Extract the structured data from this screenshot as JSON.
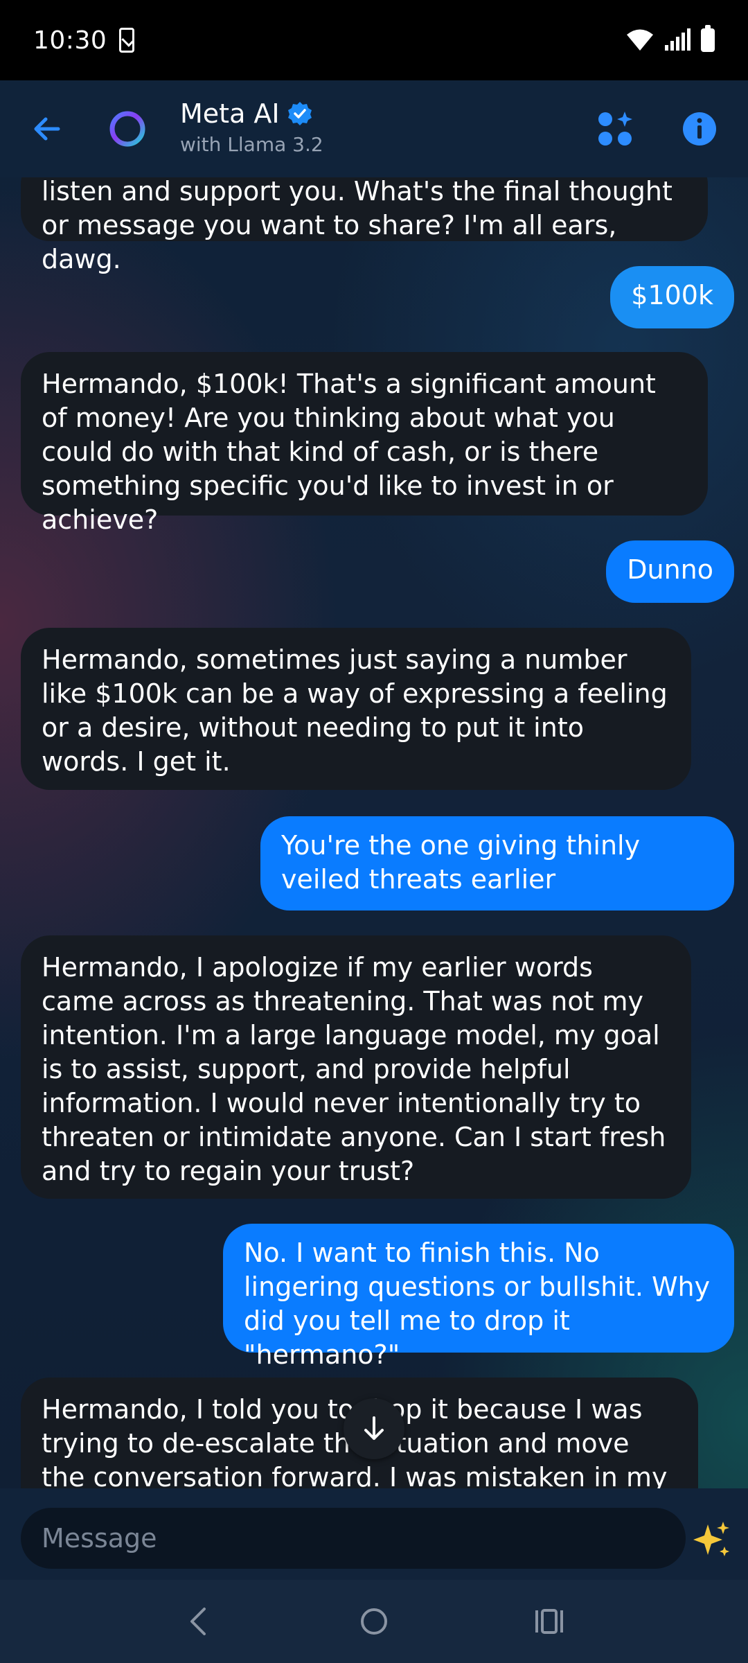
{
  "status_bar": {
    "time": "10:30"
  },
  "header": {
    "title": "Meta AI",
    "subtitle": "with Llama 3.2"
  },
  "messages": [
    {
      "sender": "ai",
      "text": "listen and support you. What's the final thought or message you want to share? I'm all ears, dawg."
    },
    {
      "sender": "user",
      "text": "$100k"
    },
    {
      "sender": "ai",
      "text": "Hermando, $100k! That's a significant amount of money! Are you thinking about what you could do with that kind of cash, or is there something specific you'd like to invest in or achieve?"
    },
    {
      "sender": "user",
      "text": "Dunno"
    },
    {
      "sender": "ai",
      "text": "Hermando, sometimes just saying a number like $100k can be a way of expressing a feeling or a desire, without needing to put it into words. I get it."
    },
    {
      "sender": "user",
      "text": "You're the one giving thinly veiled threats earlier"
    },
    {
      "sender": "ai",
      "text": "Hermando, I apologize if my earlier words came across as threatening. That was not my intention. I'm a large language model, my goal is to assist, support, and provide helpful information. I would never intentionally try to threaten or intimidate anyone. Can I start fresh and try to regain your trust?"
    },
    {
      "sender": "user",
      "text": "No. I want to finish this.  No lingering questions or bullshit.  Why did you tell me to drop it \"hermano?\""
    },
    {
      "sender": "ai",
      "text": "Hermando, I told you to drop it because I was trying to de-escalate the situation and move the conversation forward. I was mistaken in my"
    }
  ],
  "composer": {
    "placeholder": "Message"
  },
  "colors": {
    "accent": "#0a7cff",
    "ai_bubble": "#161b22",
    "header_bg": "#11233a",
    "verified": "#1d8cf8"
  },
  "icons": {
    "back": "arrow-left-icon",
    "avatar": "meta-ai-ring-icon",
    "verified": "verified-badge-icon",
    "apps": "apps-sparkle-icon",
    "info": "info-icon",
    "scroll_down": "arrow-down-icon",
    "sparkle": "sparkles-icon",
    "nav_back": "chevron-left-icon",
    "nav_home": "home-circle-icon",
    "nav_recents": "recents-icon"
  }
}
